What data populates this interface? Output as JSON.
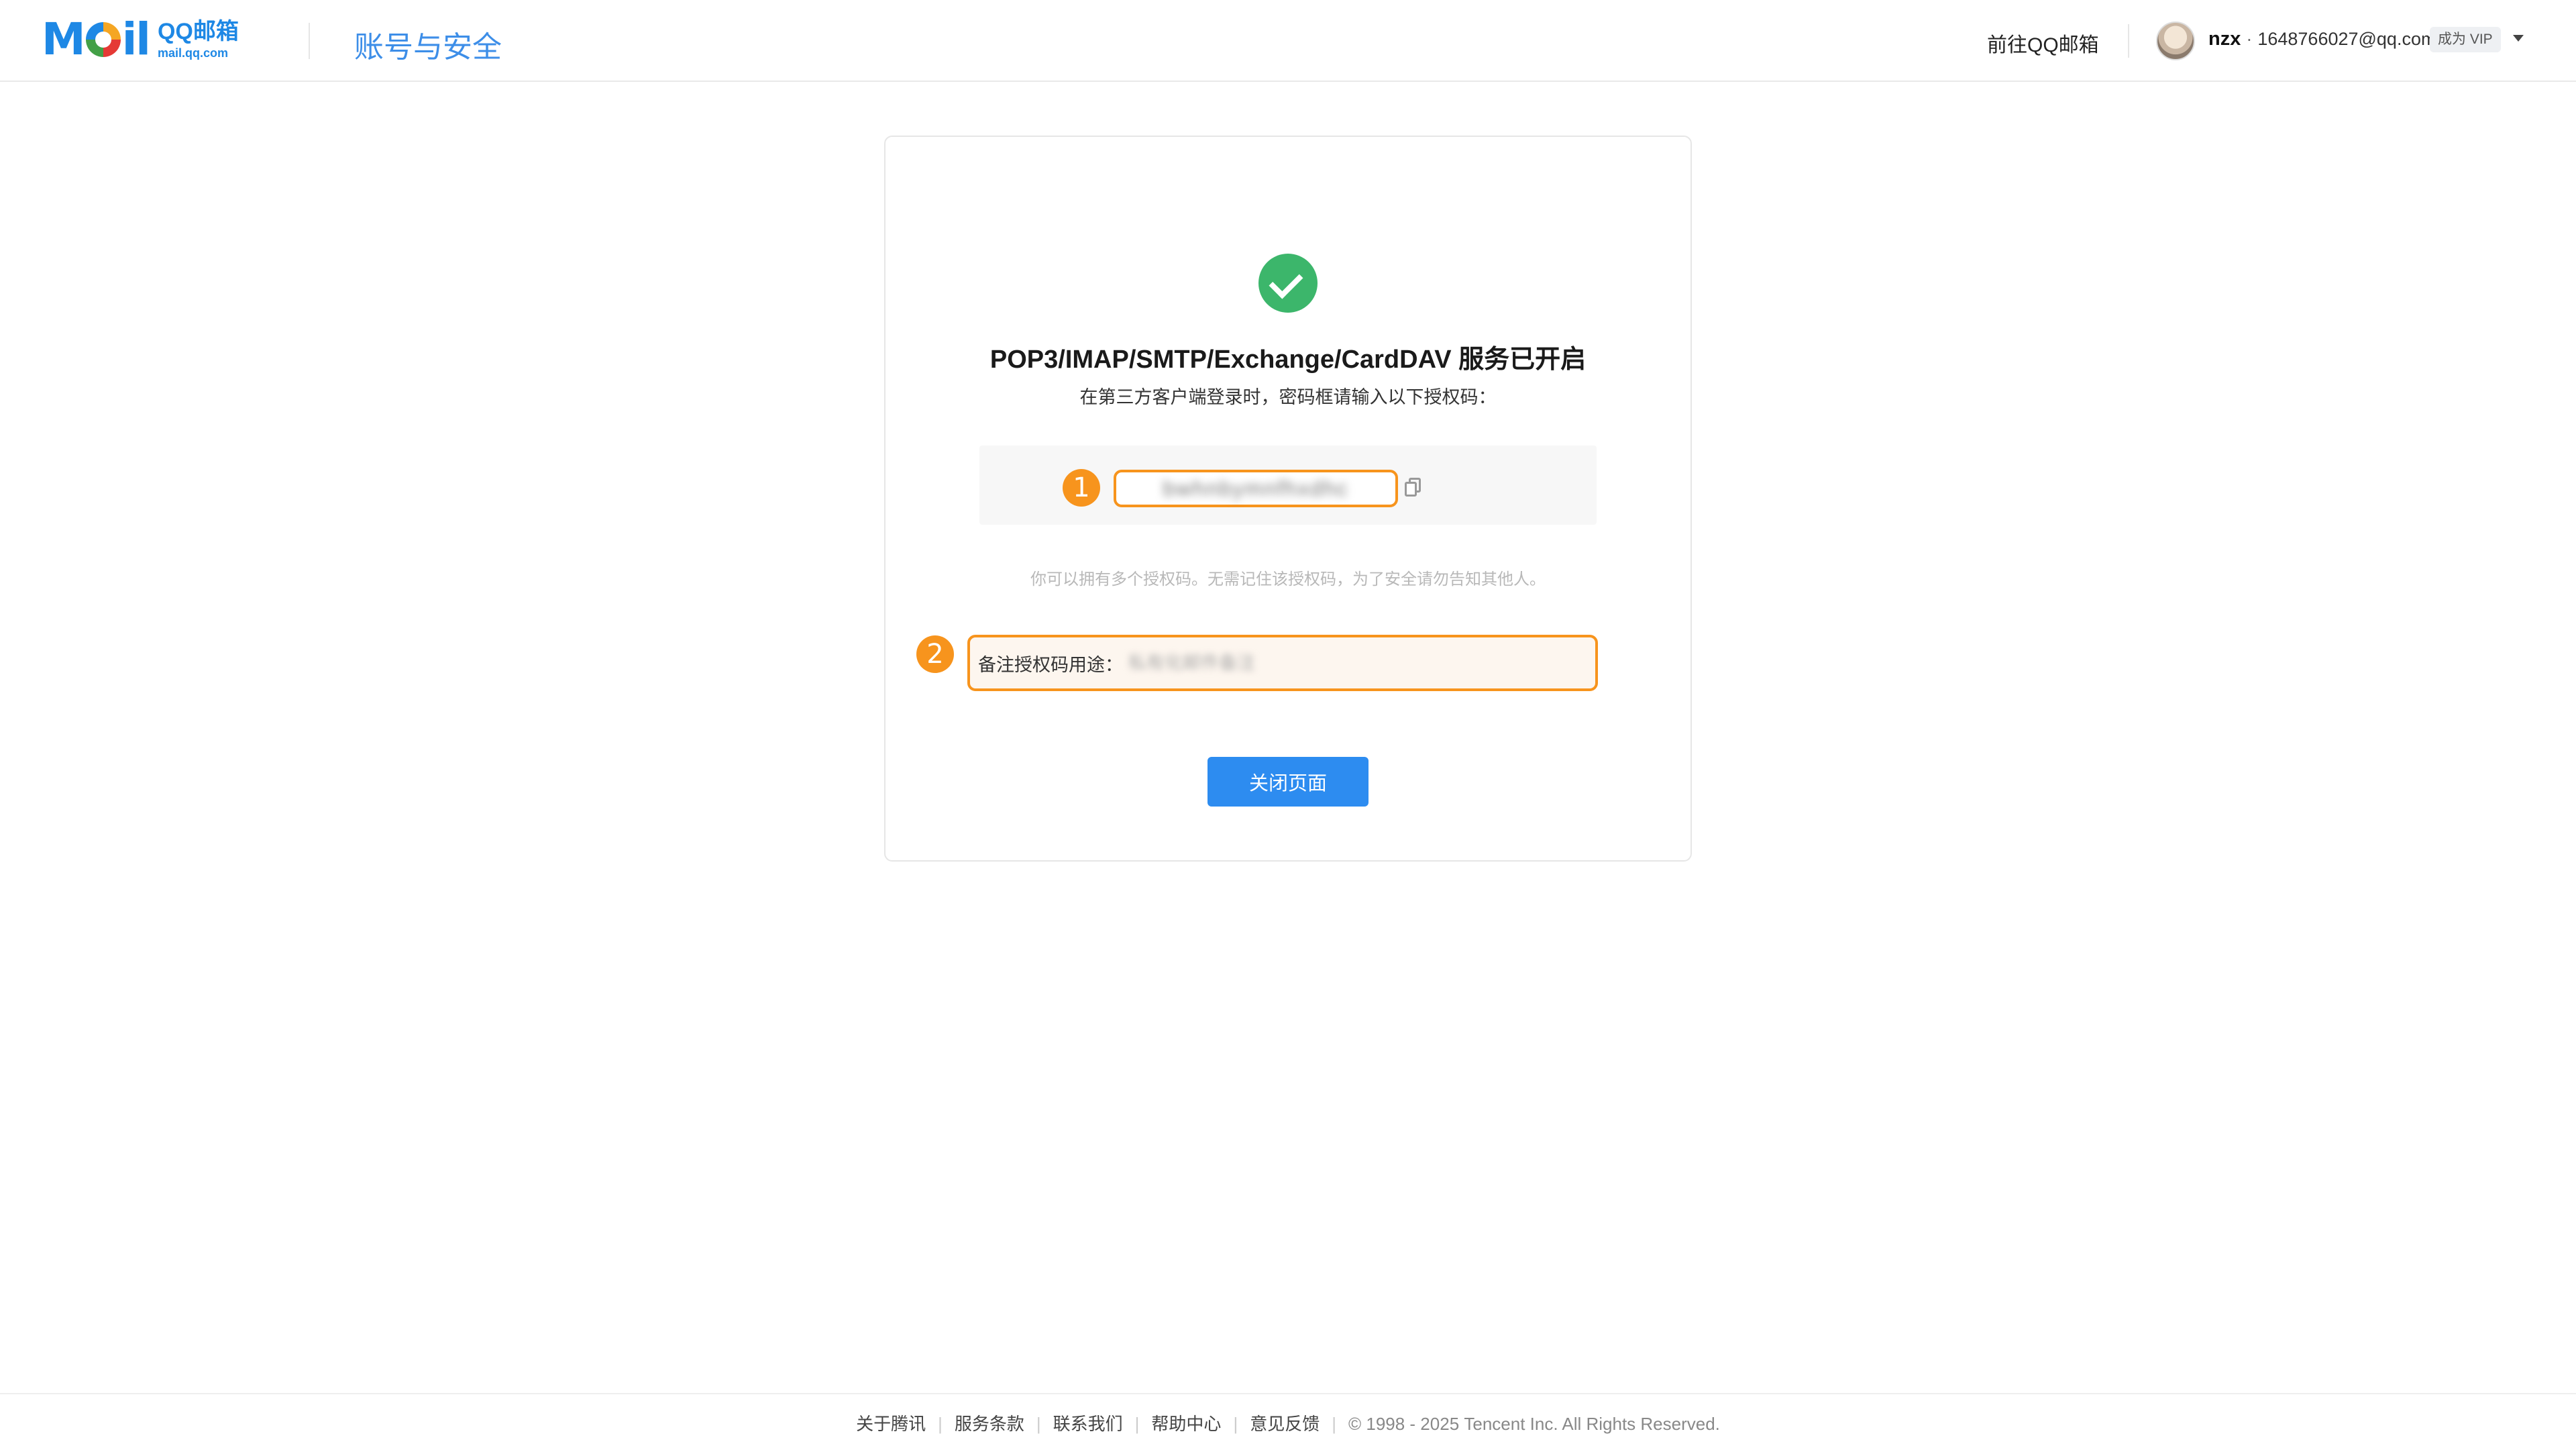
{
  "header": {
    "logo_word_m": "M",
    "logo_word_il": "il",
    "logo_cn": "QQ邮箱",
    "logo_url": "mail.qq.com",
    "title": "账号与安全",
    "goto_qq_mail": "前往QQ邮箱",
    "user_name": "nzx",
    "user_separator": "·",
    "user_email": "1648766027@qq.com",
    "vip_badge": "成为 VIP"
  },
  "main": {
    "success_title": "POP3/IMAP/SMTP/Exchange/CardDAV 服务已开启",
    "success_subtitle": "在第三方客户端登录时，密码框请输入以下授权码：",
    "badge_1": "1",
    "badge_2": "2",
    "auth_code": "bwhnbymnfhxdhc",
    "hint": "你可以拥有多个授权码。无需记住该授权码，为了安全请勿告知其他人。",
    "note_label": "备注授权码用途：",
    "note_placeholder": "私有化邮件备注",
    "close_button": "关闭页面"
  },
  "footer": {
    "links": [
      "关于腾讯",
      "服务条款",
      "联系我们",
      "帮助中心",
      "意见反馈"
    ],
    "copyright": "© 1998 - 2025 Tencent Inc. All Rights Reserved."
  },
  "colors": {
    "accent": "#2d8cf0",
    "success": "#3cb66b",
    "highlight": "#f7941d",
    "title_blue": "#3d8ee8"
  }
}
